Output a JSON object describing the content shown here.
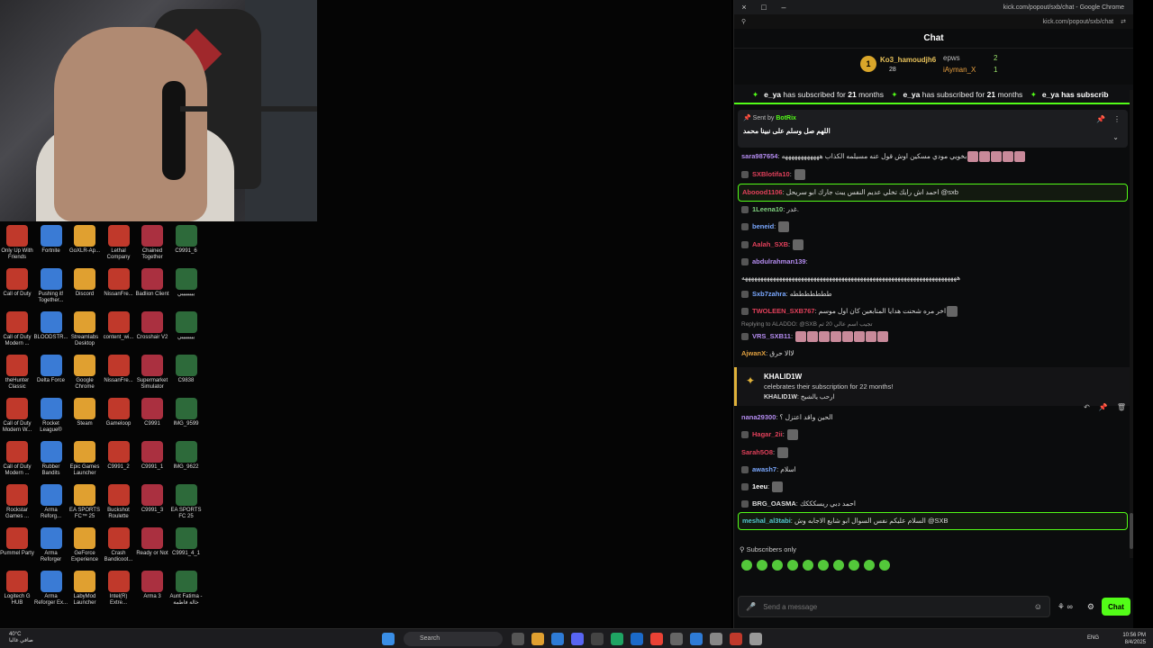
{
  "chrome": {
    "title": "kick.com/popout/sxb/chat - Google Chrome",
    "url": "kick.com/popout/sxb/chat",
    "controls": [
      "×",
      "□",
      "–"
    ]
  },
  "chat": {
    "header": "Chat",
    "leaderboard": {
      "top_name": "Ko3_hamoudjh6",
      "top_count": "28",
      "second_name": "epws",
      "second_count": "2",
      "third_name": "iAyman_X",
      "third_count": "1"
    },
    "sub_banner": {
      "user": "e_ya",
      "text_a": "has subscribed for",
      "months": "21",
      "text_b": "months",
      "tail": "e_ya has subscrib"
    },
    "pinned": {
      "sent_by_label": "Sent by",
      "bot_name": "BotRix",
      "message": "اللهم صل وسلم على نبينا محمد"
    },
    "messages": [
      {
        "user": "sara987654",
        "color": "#b48cf0",
        "text": "بخويي مودي مسكين اوش قول عنه مسيلمه الكذاب ههههههههههههه",
        "emotes": 5,
        "hl": false,
        "badge": false
      },
      {
        "user": "SXBlotifa10",
        "color": "#e0405a",
        "text": "",
        "emotes": 1,
        "hl": false,
        "badge": true
      },
      {
        "user": "Aboood1106",
        "color": "#e0405a",
        "text": "احمد اش رايك تخلي عديم النفس يبث جارك ابو سريحل @sxb",
        "emotes": 0,
        "hl": true,
        "badge": false
      },
      {
        "user": "1Leena10",
        "color": "#7fd07f",
        "text": "غدر.",
        "emotes": 0,
        "hl": false,
        "badge": true
      },
      {
        "user": "beneid",
        "color": "#7aa8ff",
        "text": "",
        "emotes": 1,
        "hl": false,
        "badge": true
      },
      {
        "user": "Aalah_SXB",
        "color": "#e0405a",
        "text": "",
        "emotes": 1,
        "hl": false,
        "badge": true
      },
      {
        "user": "abdulrahman139",
        "color": "#b48cf0",
        "text": "",
        "emotes": 0,
        "hl": false,
        "badge": true
      },
      {
        "user": "",
        "color": "#ddd",
        "text": "هههههههههههههههههههههههههههههههههههههههههههههههههههههههههههههههههههههه",
        "emotes": 0,
        "hl": false,
        "badge": false
      },
      {
        "user": "Sxb7zahra",
        "color": "#7aa8ff",
        "text": "طططططططه",
        "emotes": 0,
        "hl": false,
        "badge": true
      },
      {
        "user": "TWOLEEN_SXB767",
        "color": "#e0405a",
        "text": "اخر مره شحنت هدايا المتابعين كان اول موسم",
        "emotes": 1,
        "hl": false,
        "badge": true
      }
    ],
    "reply_line": "Replying to ALADDO: @SXB تجيب اسم عالي 20 ثم",
    "messages2": [
      {
        "user": "VRS_SXB11",
        "color": "#b48cf0",
        "text": "",
        "emotes": 8,
        "hl": false,
        "badge": true
      },
      {
        "user": "AjwanX",
        "color": "#e0a040",
        "text": "لاالا حرق",
        "emotes": 0,
        "hl": false,
        "badge": false
      }
    ],
    "subcard": {
      "user": "KHALID1W",
      "text": "celebrates their subscription for 22 months!",
      "reply_user": "KHALID1W",
      "reply_text": "ارحب يالشيخ"
    },
    "messages3": [
      {
        "user": "nana29300",
        "color": "#b48cf0",
        "text": "الحين واقد اعتزل ؟",
        "emotes": 0,
        "hl": false,
        "badge": false
      },
      {
        "user": "Hagar_2ii",
        "color": "#e0405a",
        "text": "",
        "emotes": 1,
        "hl": false,
        "badge": true
      },
      {
        "user": "Sarah5O8",
        "color": "#e0405a",
        "text": "",
        "emotes": 1,
        "hl": false,
        "badge": false
      },
      {
        "user": "awash7",
        "color": "#7aa8ff",
        "text": "اسلام",
        "emotes": 0,
        "hl": false,
        "badge": true
      },
      {
        "user": "1eeu",
        "color": "#fff",
        "text": "",
        "emotes": 1,
        "hl": false,
        "badge": true
      },
      {
        "user": "BRG_OASMA",
        "color": "#ddd",
        "text": "احمد دبي ريسكككك",
        "emotes": 0,
        "hl": false,
        "badge": true
      },
      {
        "user": "meshal_al3tabi",
        "color": "#53c8d0",
        "text": "السلام عليكم نفس السوال ابو شايع الاجابه وش @SXB",
        "emotes": 0,
        "hl": true,
        "badge": false
      }
    ],
    "subs_only": "Subscribers only",
    "composer_placeholder": "Send a message",
    "chat_button": "Chat"
  },
  "desktop": {
    "icons": [
      [
        "Only Up With Friends",
        "Fortnite",
        "GoXLR-Ap...",
        "Lethal Company",
        "Chained Together",
        "C9991_6"
      ],
      [
        "Call of Duty",
        "Pushing it! Together...",
        "Discord",
        "NissanFre...",
        "Badlion Client",
        "ييييييييي"
      ],
      [
        "Call of Duty Modern ...",
        "BLOODSTR...",
        "Streamlabs Desktop",
        "content_wi...",
        "Crosshair V2",
        "ييييييييي"
      ],
      [
        "theHunter Classic",
        "Delta Force",
        "Google Chrome",
        "NissanFre...",
        "Supermarket Simulator",
        "C9838"
      ],
      [
        "Call of Duty Modern W...",
        "Rocket League®",
        "Steam",
        "Gameloop",
        "C9991",
        "IMG_9599"
      ],
      [
        "Call of Duty Modern ...",
        "Rubber Bandits",
        "Epic Games Launcher",
        "C9991_2",
        "C9991_1",
        "IMG_9622"
      ],
      [
        "Rockstar Games ...",
        "Arma Reforg...",
        "EA SPORTS FC™ 25",
        "Buckshot Roulette",
        "C9991_3",
        "EA SPORTS FC 25"
      ],
      [
        "Pummel Party",
        "Arma Reforger",
        "GeForce Experience",
        "Crash Bandicoot...",
        "Ready or Not",
        "C9991_4_1"
      ],
      [
        "Logitech G HUB",
        "Arma Reforger Ex...",
        "LabyMod Launcher",
        "Intel(R) Extre...",
        "Arma 3",
        "Aunt Fatima - خالة فاطمة"
      ]
    ],
    "icon_colors": [
      "#c0392b",
      "#3a7bd5",
      "#e0a030",
      "#c0392b",
      "#aa3040",
      "#2d6a3a"
    ]
  },
  "taskbar": {
    "weather_temp": "40°C",
    "weather_text": "صافي غالبا",
    "search": "Search",
    "lang": "ENG",
    "time": "10:56 PM",
    "date": "8/4/2025"
  }
}
